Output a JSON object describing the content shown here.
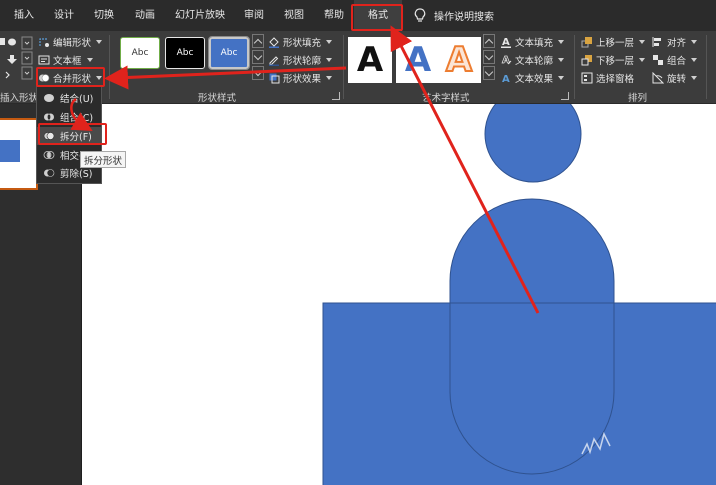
{
  "tabs": [
    {
      "id": "insert",
      "label": "插入"
    },
    {
      "id": "design",
      "label": "设计"
    },
    {
      "id": "transitions",
      "label": "切换"
    },
    {
      "id": "animations",
      "label": "动画"
    },
    {
      "id": "slideshow",
      "label": "幻灯片放映"
    },
    {
      "id": "review",
      "label": "审阅"
    },
    {
      "id": "view",
      "label": "视图"
    },
    {
      "id": "help",
      "label": "帮助"
    },
    {
      "id": "format",
      "label": "格式",
      "active": true
    }
  ],
  "search_label": "操作说明搜索",
  "insert_shapes": {
    "label": "插入形状",
    "edit_shape": "编辑形状",
    "text_box": "文本框",
    "merge_shapes": "合并形状"
  },
  "shape_styles": {
    "label": "形状样式",
    "swatches": [
      "Abc",
      "Abc",
      "Abc"
    ],
    "fill": "形状填充",
    "outline": "形状轮廓",
    "effects": "形状效果"
  },
  "wordart": {
    "label": "艺术字样式",
    "samples": [
      "A",
      "A",
      "A"
    ],
    "text_fill": "文本填充",
    "text_outline": "文本轮廓",
    "text_effects": "文本效果"
  },
  "arrange": {
    "label": "排列",
    "bring_forward": "上移一层",
    "send_backward": "下移一层",
    "selection_pane": "选择窗格",
    "align": "对齐",
    "group": "组合",
    "rotate": "旋转"
  },
  "merge_menu": {
    "items": [
      {
        "id": "union",
        "label": "结合(U)"
      },
      {
        "id": "combine",
        "label": "组合(C)"
      },
      {
        "id": "fragment",
        "label": "拆分(F)"
      },
      {
        "id": "intersect",
        "label": "相交(I)"
      },
      {
        "id": "subtract",
        "label": "剪除(S)"
      }
    ],
    "tooltip": "拆分形状"
  },
  "colors": {
    "shape_blue": "#4472c4",
    "shape_outline": "#2f528f",
    "highlight_red": "#e0231c",
    "ribbon_bg": "#3c3c3c",
    "tabbar_bg": "#2b2b2b"
  }
}
